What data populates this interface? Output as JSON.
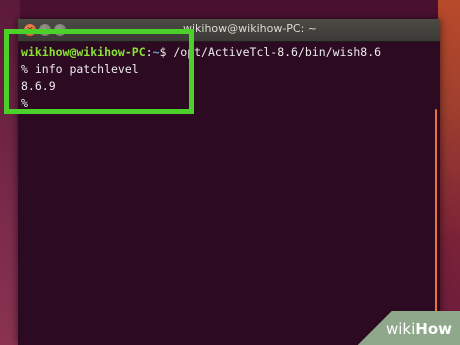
{
  "window": {
    "title": "wikihow@wikihow-PC: ~"
  },
  "terminal": {
    "prompt_user": "wikihow@wikihow-PC",
    "prompt_sep": ":",
    "prompt_path": "~",
    "prompt_symbol": "$ ",
    "command": "/opt/ActiveTcl-8.6/bin/wish8.6",
    "line2": "% info patchlevel",
    "line3": "8.6.9",
    "line4": "%"
  },
  "watermark": {
    "prefix": "wiki",
    "suffix": "How"
  },
  "colors": {
    "highlight": "#4bd12a",
    "prompt_user": "#8ae234",
    "prompt_path": "#729fcf",
    "terminal_bg": "#2c0a22",
    "accent": "#e8743b"
  }
}
